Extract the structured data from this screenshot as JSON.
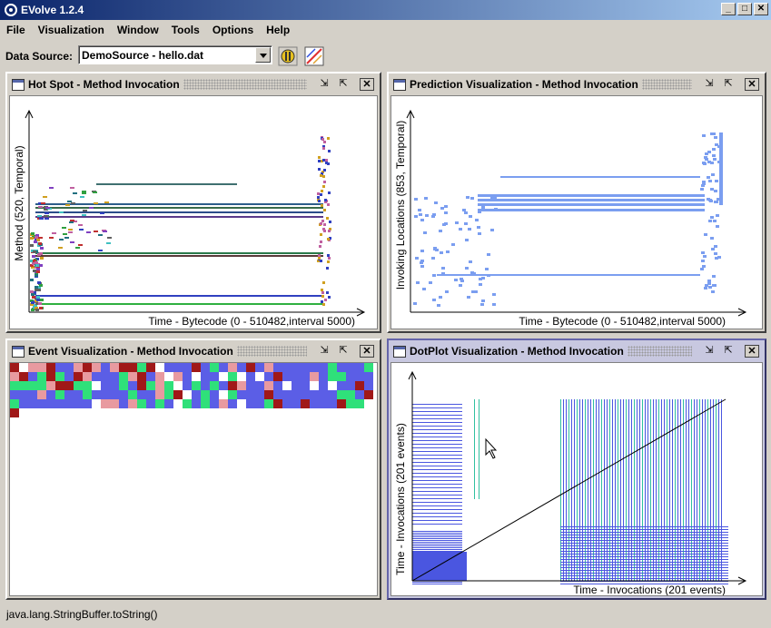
{
  "window": {
    "title": "EVolve 1.2.4",
    "buttons": [
      "_",
      "□",
      "✕"
    ]
  },
  "menu": [
    "File",
    "Visualization",
    "Window",
    "Tools",
    "Options",
    "Help"
  ],
  "toolbar": {
    "data_source_label": "Data Source:",
    "data_source_value": "DemoSource - hello.dat",
    "icons": [
      "run-icon",
      "chart-icon"
    ]
  },
  "panels": {
    "hotspot": {
      "title": "Hot Spot - Method Invocation",
      "ylabel": "Method (520, Temporal)",
      "xlabel": "Time - Bytecode (0 - 510482,interval 5000)"
    },
    "prediction": {
      "title": "Prediction Visualization - Method Invocation",
      "ylabel": "Invoking Locations (853, Temporal)",
      "xlabel": "Time - Bytecode (0 - 510482,interval 5000)"
    },
    "event": {
      "title": "Event Visualization - Method Invocation"
    },
    "dotplot": {
      "title": "DotPlot Visualization - Method Invocation",
      "ylabel": "Time - Invocations (201 events)",
      "xlabel": "Time - Invocations (201 events)"
    }
  },
  "colors": {
    "prediction_mark": "#7b9ef0",
    "dotplot_mark": "#4a56e0",
    "event_palette": [
      "#5b5ee6",
      "#a01818",
      "#2fe07a",
      "#e89aa0",
      "#ffffff",
      "#5b5ee6",
      "#2fe07a",
      "#e89aa0"
    ]
  },
  "status": {
    "text": "java.lang.StringBuffer.toString()"
  }
}
